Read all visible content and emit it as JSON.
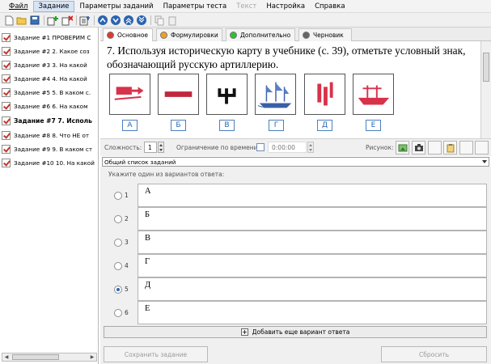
{
  "menu": [
    "Файл",
    "Задание",
    "Параметры заданий",
    "Параметры теста",
    "Текст",
    "Настройка",
    "Справка"
  ],
  "tree": [
    {
      "label": "Задание #1 ПРОВЕРИМ С"
    },
    {
      "label": "Задание #2 2. Какое соз"
    },
    {
      "label": "Задание #3 3. На какой"
    },
    {
      "label": "Задание #4 4. На какой"
    },
    {
      "label": "Задание #5 5. В каком с."
    },
    {
      "label": "Задание #6 6. На каком"
    },
    {
      "label": "Задание #7 7. Исполь"
    },
    {
      "label": "Задание #8 8. Что НЕ от"
    },
    {
      "label": "Задание #9 9. В каком ст"
    },
    {
      "label": "Задание #10 10. На какой"
    }
  ],
  "tabs": [
    {
      "label": "Основное",
      "color": "#e03a2c"
    },
    {
      "label": "Формулировки",
      "color": "#f0a020"
    },
    {
      "label": "Дополнительно",
      "color": "#2ec02e"
    },
    {
      "label": "Черновик",
      "color": "#666666"
    }
  ],
  "question": {
    "text": "7. Используя историческую карту в учебнике (с. 39), отметьте условный знак, обозначающий русскую артиллерию.",
    "letters": [
      "А",
      "Б",
      "В",
      "Г",
      "Д",
      "Е"
    ]
  },
  "props": {
    "complexity_label": "Сложность:",
    "complexity_value": "1",
    "time_label": "Ограничение по времени:",
    "time_value": "0:00:00",
    "picture_label": "Рисунок:"
  },
  "list_select": "Общий список заданий",
  "answers": {
    "hint": "Укажите один из вариантов ответа:",
    "options": [
      {
        "num": "1",
        "text": "А",
        "selected": false
      },
      {
        "num": "2",
        "text": "Б",
        "selected": false
      },
      {
        "num": "3",
        "text": "В",
        "selected": false
      },
      {
        "num": "4",
        "text": "Г",
        "selected": false
      },
      {
        "num": "5",
        "text": "Д",
        "selected": true
      },
      {
        "num": "6",
        "text": "Е",
        "selected": false
      }
    ],
    "add_label": "Добавить еще вариант ответа"
  },
  "buttons": {
    "save": "Сохранить задание",
    "reset": "Сбросить"
  },
  "colors": {
    "accent": "#2a64b0",
    "error": "#c0392b"
  }
}
